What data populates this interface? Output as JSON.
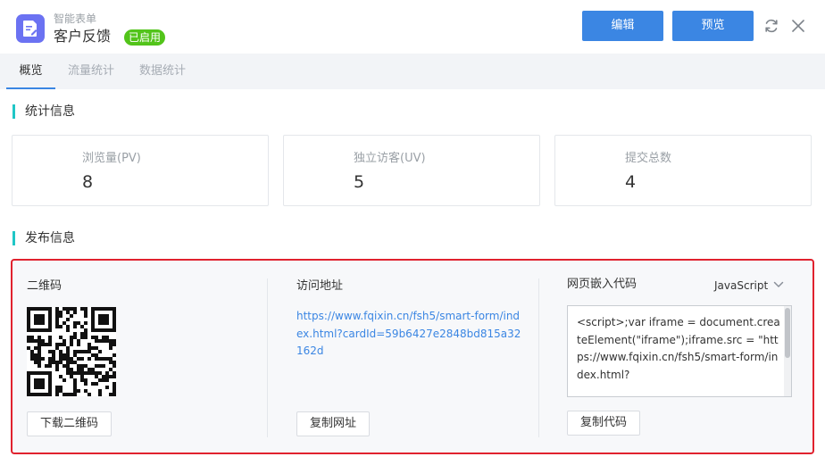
{
  "header": {
    "app_name": "智能表单",
    "form_title": "客户反馈",
    "status": "已启用",
    "edit_label": "编辑",
    "preview_label": "预览"
  },
  "tabs": [
    {
      "label": "概览",
      "active": true
    },
    {
      "label": "流量统计",
      "active": false
    },
    {
      "label": "数据统计",
      "active": false
    }
  ],
  "stats": {
    "title": "统计信息",
    "cards": [
      {
        "label": "浏览量(PV)",
        "value": "8"
      },
      {
        "label": "独立访客(UV)",
        "value": "5"
      },
      {
        "label": "提交总数",
        "value": "4"
      }
    ]
  },
  "publish": {
    "title": "发布信息",
    "qr_label": "二维码",
    "download_qr_label": "下载二维码",
    "url_label": "访问地址",
    "url": "https://www.fqixin.cn/fsh5/smart-form/index.html?cardId=59b6427e2848bd815a32162d",
    "copy_url_label": "复制网址",
    "embed_label": "网页嵌入代码",
    "embed_language": "JavaScript",
    "embed_code": "<script>;var iframe = document.createElement(\"iframe\");iframe.src = \"https://www.fqixin.cn/fsh5/smart-form/index.html?",
    "copy_code_label": "复制代码"
  },
  "colors": {
    "primary": "#3b86e3",
    "accent_bar": "#20c6c6",
    "status_green": "#52c41a",
    "highlight_border": "#e0222e",
    "app_icon": "#6b72f2"
  }
}
